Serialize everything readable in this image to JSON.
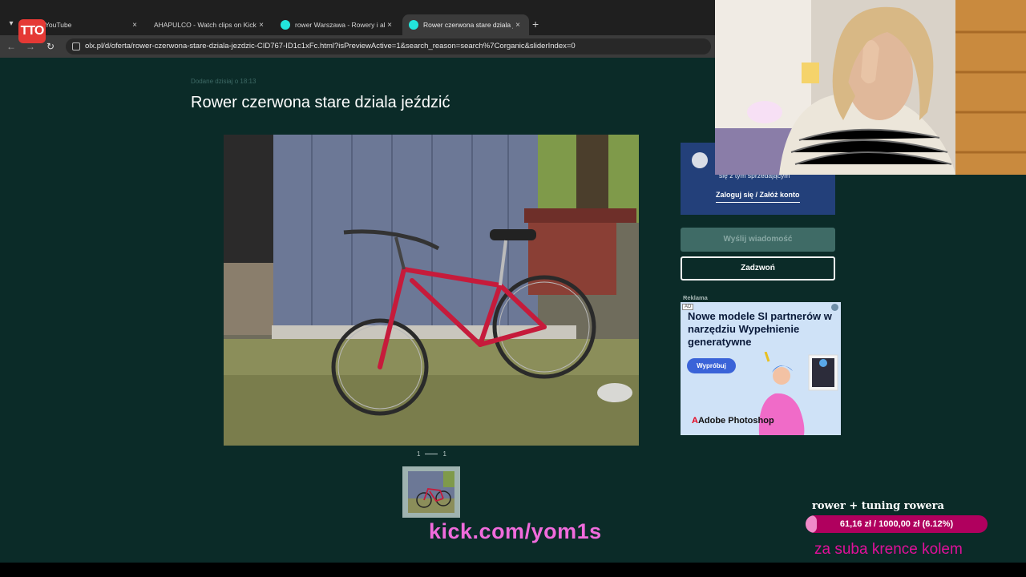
{
  "browser": {
    "tabs": [
      {
        "label": "YouTube",
        "favicon": "youtube-icon",
        "active": false
      },
      {
        "label": "AHAPULCO - Watch clips on Kick",
        "favicon": "kick-icon",
        "active": false
      },
      {
        "label": "rower Warszawa - Rowery i akcesoria",
        "favicon": "olx-icon",
        "active": false
      },
      {
        "label": "Rower czerwona stare dziala jeździć",
        "favicon": "olx-icon",
        "active": true
      }
    ],
    "url": "olx.pl/d/oferta/rower-czerwona-stare-dziala-jezdzic-CID767-ID1c1xFc.html?isPreviewActive=1&search_reason=search%7Corganic&sliderIndex=0",
    "close_glyph": "×",
    "new_tab_glyph": "+"
  },
  "stream_logo": "TTO",
  "listing": {
    "added": "Dodane dzisiaj o 18:13",
    "title": "Rower czerwona stare dziala jeździć",
    "photo_index": "1",
    "photo_total": "1"
  },
  "seller": {
    "contact_text": "się z tym sprzedającym",
    "login_link": "Zaloguj się / Załóż konto"
  },
  "actions": {
    "message": "Wyślij wiadomość",
    "call": "Zadzwoń"
  },
  "ad": {
    "label": "Reklama",
    "badge": "AD",
    "headline": "Nowe modele SI partnerów w narzędziu Wypełnienie generatywne",
    "cta": "Wypróbuj",
    "brand_mark": "A",
    "brand": "Adobe Photoshop"
  },
  "overlay": {
    "kick_url": "kick.com/yom1s",
    "goal_title": "rower + tuning rowera",
    "goal_progress_text": "61,16 zł / 1000,00 zł (6.12%)",
    "goal_fraction": 0.0612,
    "sub_text": "za suba krence kolem"
  },
  "colors": {
    "page_bg": "#0b2b28",
    "seller_bg": "#23407a",
    "kick_pink": "#f06bdc",
    "goal_bar": "#b0005e"
  }
}
